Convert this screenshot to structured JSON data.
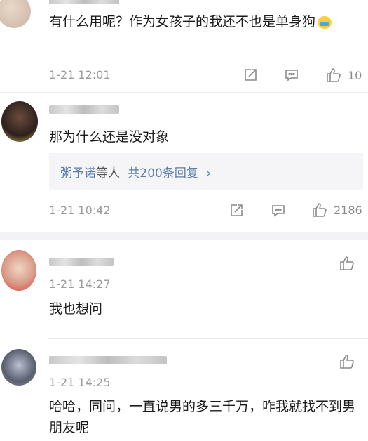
{
  "comments": [
    {
      "text": "有什么用呢？作为女孩子的我还不也是单身狗",
      "emoji": "sweat-smile-emoji",
      "time": "1-21 12:01",
      "like_count": "10"
    },
    {
      "text": "那为什么还是没对象",
      "reply_preview": {
        "user": "粥予诺",
        "middle": "等人",
        "count_text": "共200条回复",
        "chevron": "›"
      },
      "time": "1-21 10:42",
      "like_count": "2186"
    }
  ],
  "replies": [
    {
      "time": "1-21 14:27",
      "text": "我也想问"
    },
    {
      "time": "1-21 14:25",
      "text": "哈哈，同问，一直说男的多三千万，咋我就找不到男朋友呢"
    }
  ],
  "icons": {
    "share": "share-icon",
    "comment": "comment-icon",
    "like": "thumbs-up-icon"
  },
  "colors": {
    "link": "#5b7fa8",
    "time": "#9b9b9b",
    "reply_bg": "#f5f5f7",
    "section_bg": "#f3f3f5"
  }
}
